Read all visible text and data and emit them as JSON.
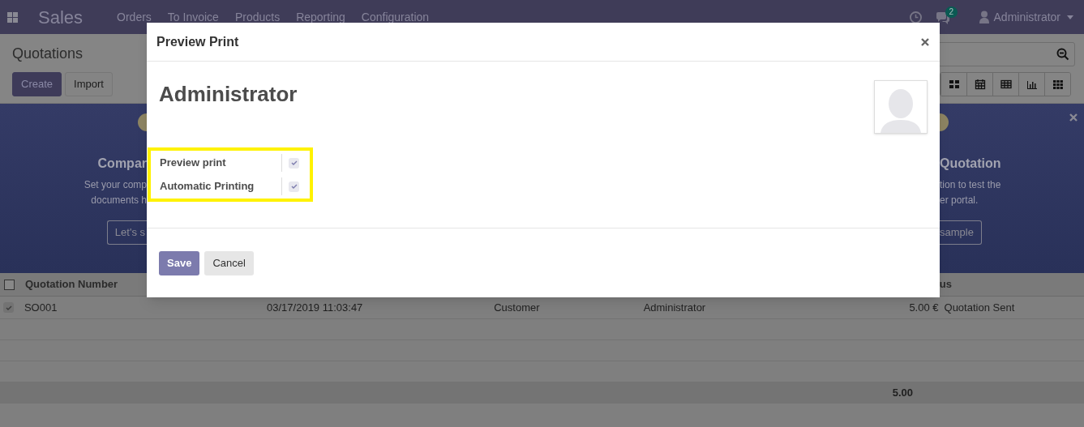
{
  "navbar": {
    "app": "Sales",
    "menu": [
      "Orders",
      "To Invoice",
      "Products",
      "Reporting",
      "Configuration"
    ],
    "messages_badge": "2",
    "user": "Administrator"
  },
  "control_panel": {
    "title": "Quotations",
    "buttons": [
      {
        "label": "Create",
        "kind": "primary"
      },
      {
        "label": "Import",
        "kind": "secondary"
      }
    ],
    "views": [
      {
        "kind": "kanban",
        "selected": false
      },
      {
        "kind": "calendar",
        "selected": false
      },
      {
        "kind": "list",
        "selected": false
      },
      {
        "kind": "graph",
        "selected": false
      },
      {
        "kind": "pivot",
        "selected": false
      }
    ]
  },
  "banner": {
    "left": {
      "heading": "Compar",
      "lines": [
        "Set your comp",
        "documents h"
      ],
      "button": "Let's s"
    },
    "right": {
      "heading": "Quotation",
      "lines": [
        "tion to test the",
        "er portal."
      ],
      "button": "sample"
    }
  },
  "table": {
    "select_all": {
      "checked": false
    },
    "columns": [
      "Quotation Number",
      "us"
    ],
    "rows": [
      {
        "checked": true,
        "cells": [
          "SO001",
          "03/17/2019 11:03:47",
          "Customer",
          "Administrator",
          "5.00 €",
          "Quotation Sent"
        ]
      }
    ],
    "total": "5.00"
  },
  "dialog": {
    "title": "Preview Print",
    "name": "Administrator",
    "fields": [
      {
        "label": "Preview print",
        "checked": true
      },
      {
        "label": "Automatic Printing",
        "checked": true
      }
    ],
    "buttons": [
      {
        "label": "Save",
        "kind": "primary"
      },
      {
        "label": "Cancel",
        "kind": "secondary"
      }
    ]
  }
}
